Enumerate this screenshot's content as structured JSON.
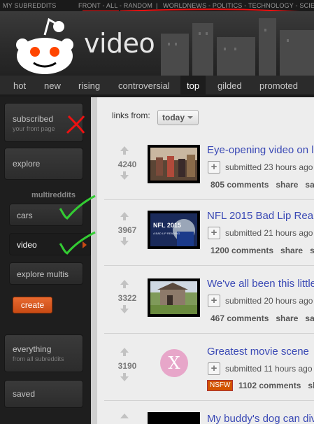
{
  "srbar": {
    "my_subreddits": "MY SUBREDDITS",
    "special": "FRONT - ALL - RANDOM",
    "divider": "|",
    "list": "WORLDNEWS - POLITICS - TECHNOLOGY - SCIENCE"
  },
  "header": {
    "title": "video"
  },
  "tabs": [
    {
      "label": "hot"
    },
    {
      "label": "new"
    },
    {
      "label": "rising"
    },
    {
      "label": "controversial"
    },
    {
      "label": "top"
    },
    {
      "label": "gilded"
    },
    {
      "label": "promoted"
    }
  ],
  "sidebar": {
    "subscribed": {
      "label": "subscribed",
      "sub": "your front page"
    },
    "explore": "explore",
    "multis_heading": "multireddits",
    "multis": [
      "cars",
      "video",
      "explore multis"
    ],
    "create": "create",
    "everything": {
      "label": "everything",
      "sub": "from all subreddits"
    },
    "saved": "saved"
  },
  "content": {
    "links_from_label": "links from:",
    "time_filter": "today",
    "posts": [
      {
        "score": "4240",
        "title": "Eye-opening video on l",
        "tagline": "submitted 23 hours ago",
        "comments": "805 comments",
        "share": "share",
        "extra": "sa"
      },
      {
        "score": "3967",
        "title": "NFL 2015 Bad Lip Rea",
        "tagline": "submitted 21 hours ago",
        "comments": "1200 comments",
        "share": "share",
        "extra": "s",
        "thumb_text": "NFL 2015",
        "thumb_sub": "A BAD LIP READING"
      },
      {
        "score": "3322",
        "title": "We've all been this little",
        "tagline": "submitted 20 hours ago",
        "comments": "467 comments",
        "share": "share",
        "extra": "sa"
      },
      {
        "score": "3190",
        "title": "Greatest movie scene",
        "tagline": "submitted 11 hours ago",
        "comments": "1102 comments",
        "share": "sh",
        "nsfw": "NSFW",
        "thumb_letter": "X"
      },
      {
        "title": "My buddy's dog can div"
      }
    ]
  },
  "colors": {
    "accent": "#3a49b5",
    "annotation_red": "#e11",
    "annotation_green": "#3c3"
  }
}
